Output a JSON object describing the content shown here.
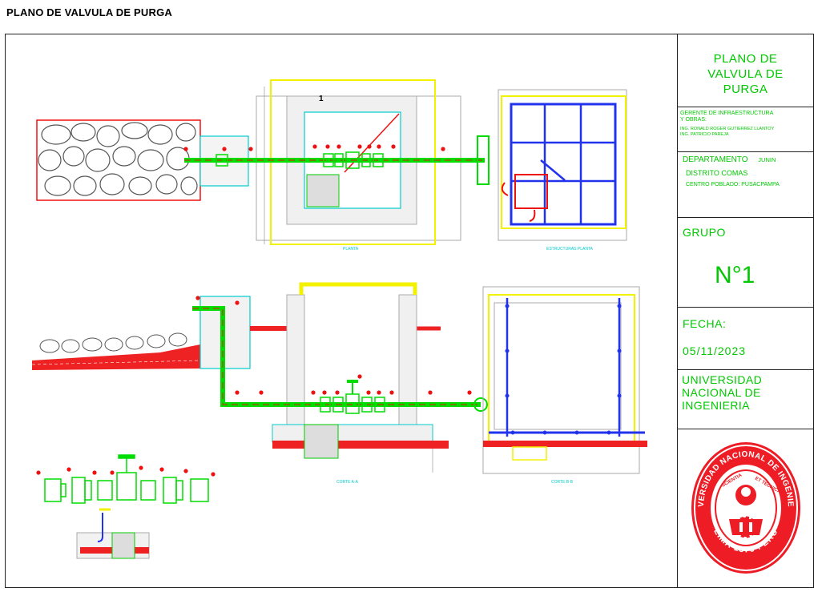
{
  "header": {
    "title": "PLANO DE VALVULA DE PURGA"
  },
  "title_block": {
    "plan_title": [
      "PLANO DE",
      "VALVULA DE",
      "PURGA"
    ],
    "gerente_label": [
      "GERENTE DE INFRAESTRUCTURA",
      "Y OBRAS:"
    ],
    "engineers": [
      "ING. RONALD ROGER GUTIERREZ LLANTOY",
      "ING. PATRICIO PAREJA"
    ],
    "departamento_label": "DEPARTAMENTO",
    "departamento_value": "JUNIN",
    "distrito": "DISTRITO COMAS",
    "centro_poblado": "CENTRO POBLADO: PUSACPAMPA",
    "grupo_label": "GRUPO",
    "grupo_value": "N°1",
    "fecha_label": "FECHA:",
    "fecha_value": "05/11/2023",
    "university": [
      "UNIVERSIDAD",
      "NACIONAL DE",
      "INGENIERIA"
    ]
  },
  "seal": {
    "name": "UNIVERSIDAD NACIONAL DE INGENIERIA",
    "motto": [
      "SCIENTIA",
      "ET TECNICA"
    ],
    "bottom": "LIMA 1876 PERU"
  },
  "drawing": {
    "plan_marker": "1",
    "view_labels": [
      "PLANTA",
      "ESTRUCTURAS PLANTA",
      "CORTE A-A",
      "CORTE B-B"
    ],
    "colors": {
      "green": "#00dd00",
      "red": "#ee1111",
      "blue": "#2233ee",
      "cyan": "#00cccc",
      "yellow": "#f2f200",
      "grey": "#888888"
    }
  }
}
